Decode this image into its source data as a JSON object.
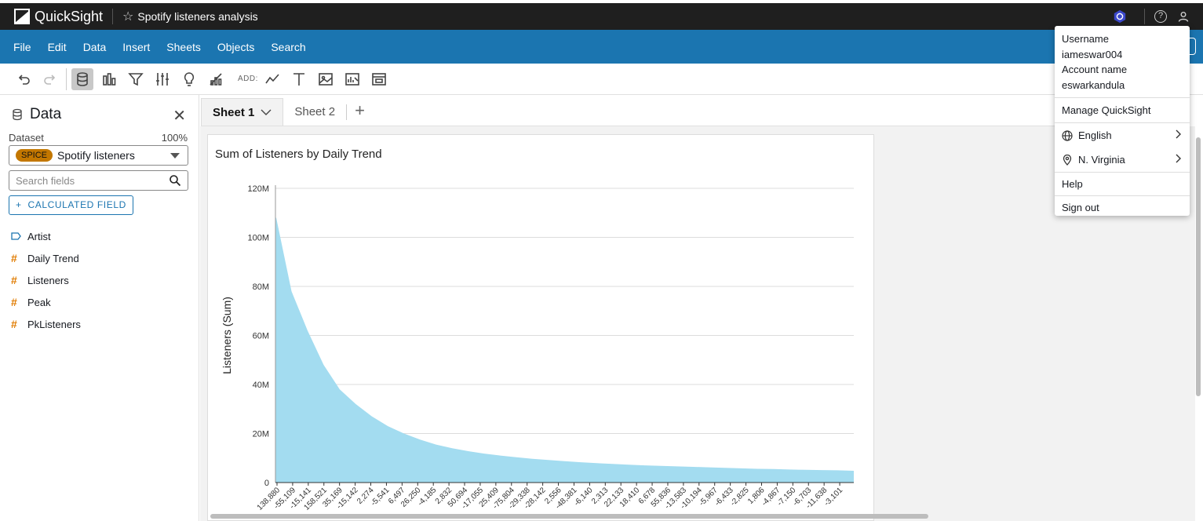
{
  "app": {
    "name": "QuickSight",
    "analysis_title": "Spotify listeners analysis"
  },
  "menubar": {
    "items": [
      "File",
      "Edit",
      "Data",
      "Insert",
      "Sheets",
      "Objects",
      "Search"
    ]
  },
  "toolbar": {
    "add_label": "ADD:"
  },
  "sidebar": {
    "title": "Data",
    "dataset_label": "Dataset",
    "dataset_pct": "100%",
    "spice_badge": "SPICE",
    "dataset_name": "Spotify listeners",
    "search_placeholder": "Search fields",
    "calc_field_label": "CALCULATED FIELD",
    "fields": [
      {
        "name": "Artist",
        "type": "dimension"
      },
      {
        "name": "Daily Trend",
        "type": "measure"
      },
      {
        "name": "Listeners",
        "type": "measure"
      },
      {
        "name": "Peak",
        "type": "measure"
      },
      {
        "name": "PkListeners",
        "type": "measure"
      }
    ]
  },
  "tabs": [
    {
      "label": "Sheet 1",
      "active": true
    },
    {
      "label": "Sheet 2",
      "active": false
    }
  ],
  "user_menu": {
    "username_label": "Username",
    "username": "iameswar004",
    "account_label": "Account name",
    "account": "eswarkandula",
    "manage": "Manage QuickSight",
    "language": "English",
    "region": "N. Virginia",
    "help": "Help",
    "signout": "Sign out"
  },
  "chart_data": {
    "type": "area",
    "title": "Sum of Listeners by Daily Trend",
    "ylabel": "Listeners (Sum)",
    "xlabel": "",
    "color": "#a3dcf0",
    "ylim": [
      0,
      120000000
    ],
    "y_ticks": [
      "0",
      "20M",
      "40M",
      "60M",
      "80M",
      "100M",
      "120M"
    ],
    "y_tick_values": [
      0,
      20000000,
      40000000,
      60000000,
      80000000,
      100000000,
      120000000
    ],
    "x_tick_labels": [
      "138,880",
      "-55,109",
      "-15,141",
      "158,521",
      "35,169",
      "-15,142",
      "2,274",
      "-5,541",
      "6,497",
      "26,250",
      "-4,185",
      "2,832",
      "50,694",
      "-17,055",
      "25,409",
      "-75,804",
      "-29,338",
      "-28,142",
      "2,556",
      "-48,381",
      "-6,140",
      "2,313",
      "22,133",
      "18,410",
      "6,678",
      "55,836",
      "-13,583",
      "-10,194",
      "-5,967",
      "-6,433",
      "-2,825",
      "1,806",
      "-4,867",
      "-7,150",
      "-6,703",
      "-11,638",
      "-3,101"
    ],
    "series_values_approx": [
      108000000,
      78000000,
      62000000,
      48000000,
      38000000,
      32000000,
      27000000,
      23000000,
      20000000,
      17500000,
      15500000,
      14000000,
      12800000,
      11800000,
      11000000,
      10300000,
      9700000,
      9200000,
      8700000,
      8300000,
      7900000,
      7600000,
      7300000,
      7000000,
      6800000,
      6600000,
      6400000,
      6200000,
      6000000,
      5800000,
      5600000,
      5500000,
      5300000,
      5200000,
      5100000,
      5000000,
      4800000
    ]
  }
}
